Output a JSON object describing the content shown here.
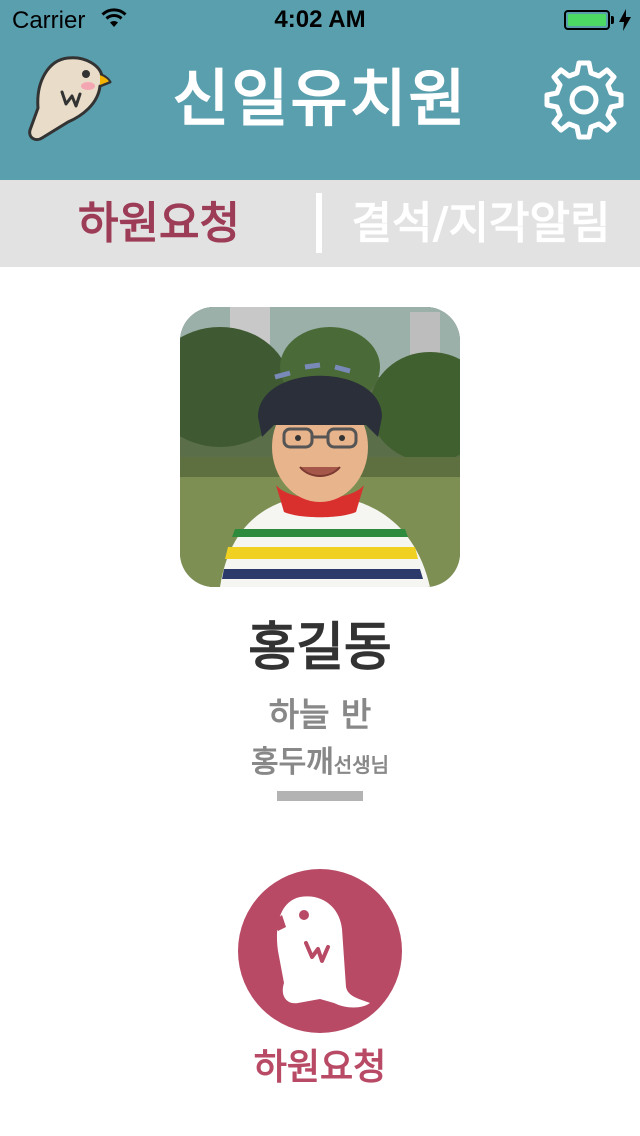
{
  "status_bar": {
    "carrier": "Carrier",
    "time": "4:02 AM",
    "battery_level": 1.0
  },
  "header": {
    "title": "신일유치원",
    "logo_icon": "bird-icon",
    "settings_icon": "gear-icon",
    "background_color": "#5a9fae"
  },
  "tabs": [
    {
      "label": "하원요청",
      "selected": true
    },
    {
      "label": "결석/지각알림",
      "selected": false
    }
  ],
  "profile": {
    "name": "홍길동",
    "class_name": "하늘 반",
    "teacher_name": "홍두깨",
    "teacher_title": "선생님"
  },
  "request_button": {
    "label": "하원요청",
    "icon": "bird-icon",
    "color": "#b84a66"
  },
  "colors": {
    "accent": "#9d3c56",
    "tab_bar": "#e2e2e2",
    "text_dark": "#333333",
    "text_muted": "#888888"
  }
}
